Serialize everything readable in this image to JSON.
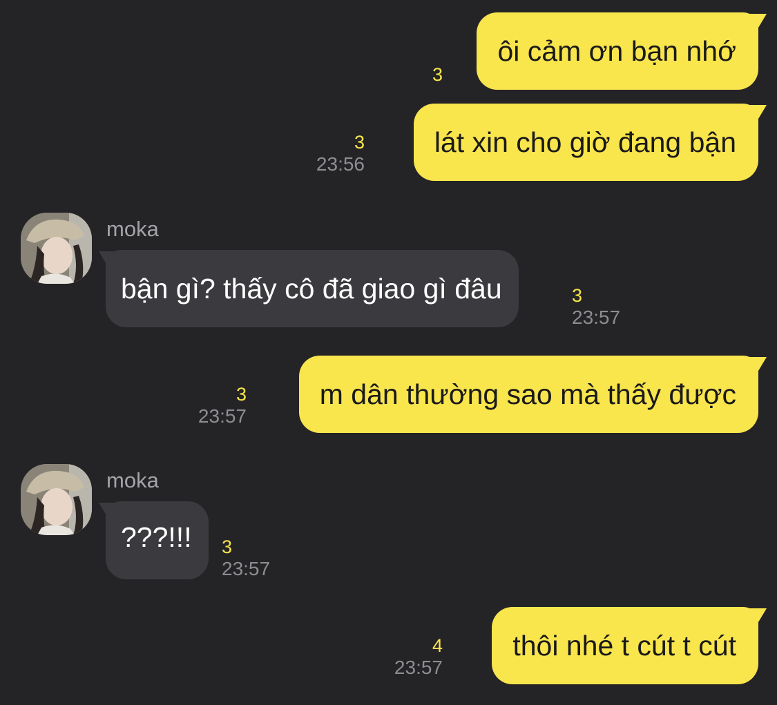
{
  "messages": [
    {
      "direction": "out",
      "text": "ôi cảm ơn bạn nhớ",
      "unread": "3",
      "time": ""
    },
    {
      "direction": "out",
      "text": "lát xin cho giờ đang bận",
      "unread": "3",
      "time": "23:56"
    },
    {
      "direction": "in",
      "sender": "moka",
      "text": "bận gì? thấy cô đã giao gì đâu",
      "unread": "3",
      "time": "23:57"
    },
    {
      "direction": "out",
      "text": "m dân thường sao mà thấy được",
      "unread": "3",
      "time": "23:57"
    },
    {
      "direction": "in",
      "sender": "moka",
      "text": "???!!!",
      "unread": "3",
      "time": "23:57"
    },
    {
      "direction": "out",
      "text": "thôi nhé t cút t cút",
      "unread": "4",
      "time": "23:57"
    }
  ],
  "colors": {
    "background": "#242427",
    "outgoing_bubble": "#f9e54c",
    "incoming_bubble": "#3b3b3f",
    "unread_count": "#f9e54c",
    "timestamp": "#8d8d92"
  },
  "icons": {
    "avatar": "profile-photo-avatar"
  }
}
